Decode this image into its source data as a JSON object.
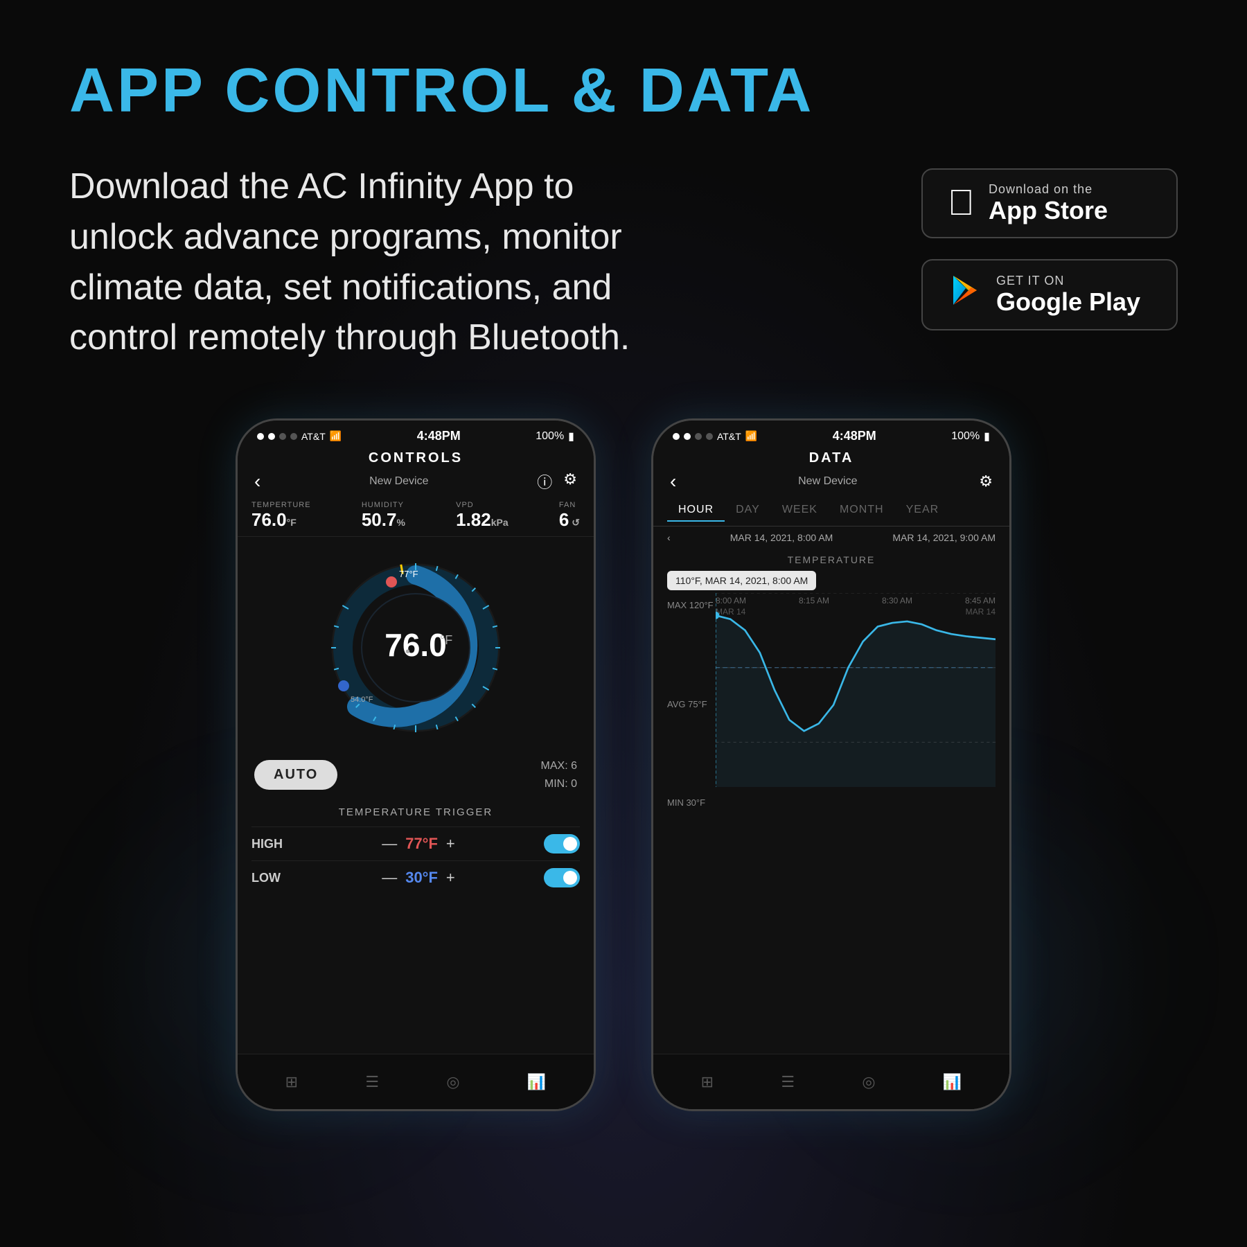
{
  "page": {
    "title": "APP CONTROL & DATA",
    "description": "Download the AC Infinity App to unlock advance programs, monitor climate data, set notifications, and control remotely through Bluetooth.",
    "background_color": "#0a0a0a",
    "accent_color": "#3ab8e8"
  },
  "badges": {
    "appstore": {
      "subtitle": "Download on the",
      "title": "App Store"
    },
    "googleplay": {
      "subtitle": "GET IT ON",
      "title": "Google Play"
    }
  },
  "phone_controls": {
    "status": {
      "carrier": "AT&T",
      "time": "4:48PM",
      "battery": "100%"
    },
    "header": {
      "screen_name": "CONTROLS",
      "device_name": "New Device"
    },
    "stats": {
      "temperature_label": "TEMPERTURE",
      "temperature_value": "76.0",
      "temperature_unit": "°F",
      "humidity_label": "HUMIDITY",
      "humidity_value": "50.7",
      "humidity_unit": "%",
      "vpd_label": "VPD",
      "vpd_value": "1.82",
      "vpd_unit": "kPa",
      "fan_label": "FAN",
      "fan_value": "6"
    },
    "gauge": {
      "temperature": "76.0",
      "unit": "°F",
      "high_marker": "77°F",
      "low_marker": "54.0°F"
    },
    "auto_mode": {
      "label": "AUTO",
      "max_label": "MAX: 6",
      "min_label": "MIN: 0"
    },
    "triggers": {
      "title": "TEMPERATURE TRIGGER",
      "high": {
        "label": "HIGH",
        "value": "77°F",
        "enabled": true
      },
      "low": {
        "label": "LOW",
        "value": "30°F",
        "enabled": true
      }
    }
  },
  "phone_data": {
    "status": {
      "carrier": "AT&T",
      "time": "4:48PM",
      "battery": "100%"
    },
    "header": {
      "screen_name": "DATA",
      "device_name": "New Device"
    },
    "tabs": [
      "HOUR",
      "DAY",
      "WEEK",
      "MONTH",
      "YEAR"
    ],
    "active_tab": "HOUR",
    "date_range": {
      "start": "MAR 14, 2021, 8:00 AM",
      "end": "MAR 14, 2021, 9:00 AM"
    },
    "chart": {
      "title": "TEMPERATURE",
      "tooltip": "110°F, MAR 14, 2021, 8:00 AM",
      "y_labels": [
        "MAX 120°F",
        "AVG 75°F",
        "MIN 30°F"
      ],
      "x_labels": [
        "8:00 AM",
        "8:15 AM",
        "8:30 AM",
        "8:45 AM"
      ],
      "date_labels": [
        "MAR 14",
        "MAR 14"
      ]
    }
  }
}
